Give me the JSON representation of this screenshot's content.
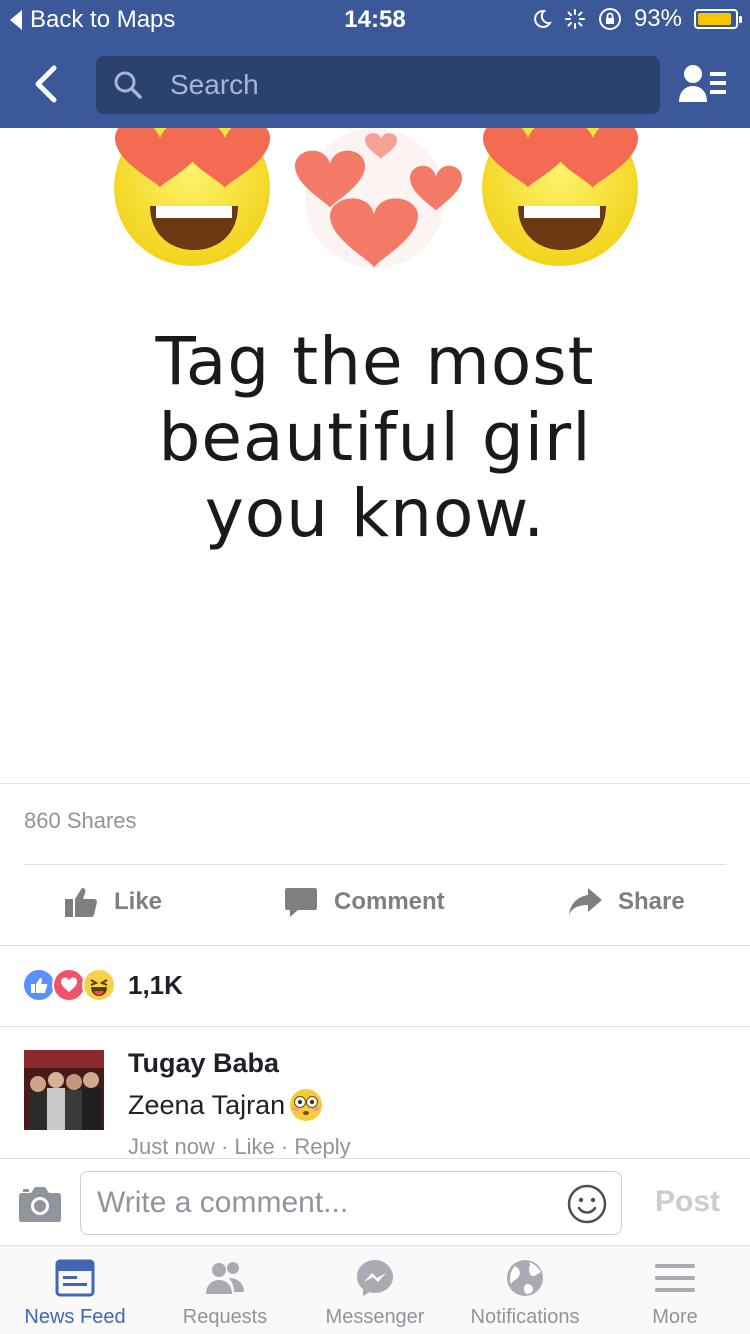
{
  "status_bar": {
    "back_label": "Back to Maps",
    "time": "14:58",
    "battery": "93%",
    "battery_level": 0.93
  },
  "nav": {
    "search_placeholder": "Search",
    "icons": [
      "back-arrow-icon",
      "search-icon",
      "friends-list-icon"
    ]
  },
  "post": {
    "image_text_lines": [
      "Tag the most",
      "beautiful girl",
      "you know."
    ],
    "shares": "860 Shares",
    "actions": {
      "like": "Like",
      "comment": "Comment",
      "share": "Share"
    },
    "reaction_count": "1,1K"
  },
  "comment": {
    "author": "Tugay Baba",
    "text": "Zeena Tajran",
    "meta_time": "Just now",
    "meta_like": "Like",
    "meta_reply": "Reply"
  },
  "comment_input": {
    "placeholder": "Write a comment...",
    "post_label": "Post"
  },
  "tabs": [
    {
      "label": "News Feed",
      "icon": "news-feed-icon",
      "active": true
    },
    {
      "label": "Requests",
      "icon": "requests-icon",
      "active": false
    },
    {
      "label": "Messenger",
      "icon": "messenger-icon",
      "active": false
    },
    {
      "label": "Notifications",
      "icon": "globe-icon",
      "active": false
    },
    {
      "label": "More",
      "icon": "menu-icon",
      "active": false
    }
  ],
  "colors": {
    "brand": "#3b5998",
    "active_tab": "#4267b2",
    "muted": "#90949c"
  }
}
